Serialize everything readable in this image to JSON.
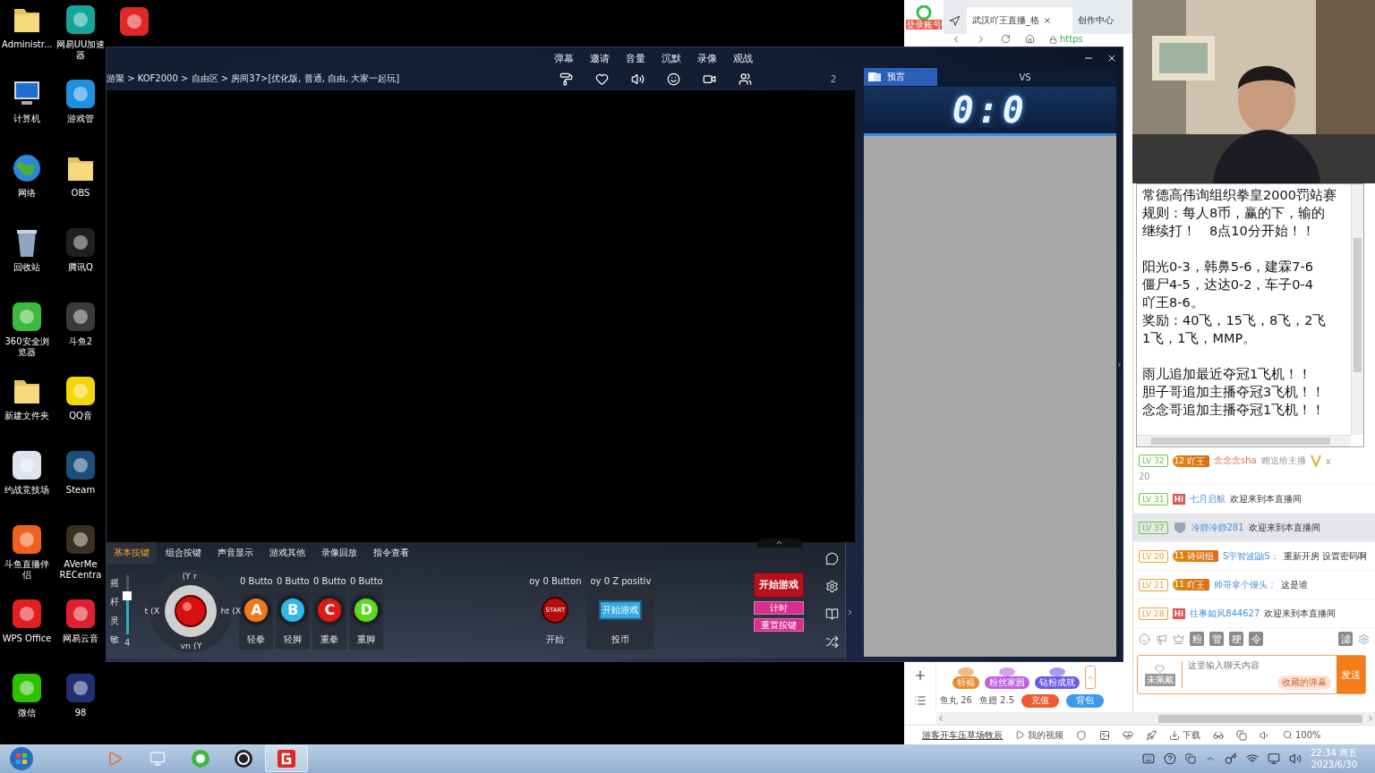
{
  "desktop": {
    "icons": [
      {
        "label": "Administr...",
        "kind": "folder"
      },
      {
        "label": "计算机",
        "kind": "computer"
      },
      {
        "label": "网络",
        "kind": "globe"
      },
      {
        "label": "回收站",
        "kind": "bin"
      },
      {
        "label": "360安全浏览器",
        "kind": "app",
        "color": "#3cba3c"
      },
      {
        "label": "新建文件夹",
        "kind": "folder"
      },
      {
        "label": "约战竞技场",
        "kind": "app",
        "color": "#dfe3f0"
      },
      {
        "label": "斗鱼直播伴侣",
        "kind": "app",
        "color": "#f06020"
      },
      {
        "label": "WPS Office",
        "kind": "app",
        "color": "#e02020"
      },
      {
        "label": "微信",
        "kind": "app",
        "color": "#2dc100"
      },
      {
        "label": "网易UU加速器",
        "kind": "app",
        "color": "#13a59a"
      },
      {
        "label": "游戏管",
        "kind": "app",
        "color": "#1e90e0"
      },
      {
        "label": "OBS",
        "kind": "folder"
      },
      {
        "label": "腾讯Q",
        "kind": "app",
        "color": "#202020"
      },
      {
        "label": "斗鱼2",
        "kind": "app",
        "color": "#3a3a3a"
      },
      {
        "label": "QQ音",
        "kind": "app",
        "color": "#f2d60a"
      },
      {
        "label": "Steam",
        "kind": "app",
        "color": "#1b4f7a"
      },
      {
        "label": "AVerMe RECentra",
        "kind": "app",
        "color": "#3a3020"
      },
      {
        "label": "网易云音",
        "kind": "app",
        "color": "#e02030"
      },
      {
        "label": "98",
        "kind": "app",
        "color": "#203070"
      },
      {
        "kind": "app",
        "color": "#e02828"
      }
    ]
  },
  "game": {
    "menu": [
      "弹幕",
      "邀请",
      "音量",
      "沉默",
      "录像",
      "观战"
    ],
    "breadcrumb": "游聚 > KOF2000 > 自由区 > 房间37>[优化版, 普通, 自由, 大家一起玩]",
    "count": "2",
    "panel": {
      "tabs": [
        {
          "label": "基本按键",
          "selected": true
        },
        {
          "label": "组合按键",
          "selected": false
        },
        {
          "label": "声音显示",
          "selected": false
        },
        {
          "label": "游戏其他",
          "selected": false
        },
        {
          "label": "录像回放",
          "selected": false
        },
        {
          "label": "指令查看",
          "selected": false
        }
      ],
      "sensitivity": {
        "label": "摇杆灵敏",
        "level": 0.65,
        "value": "4"
      },
      "joystick": {
        "up": "(Y r",
        "left": "t (X",
        "right": "ht (X",
        "down": "vn (Y"
      },
      "buttons": [
        {
          "key": "A",
          "mapping": "0 Butto",
          "label": "轻拳",
          "color": "#f07820"
        },
        {
          "key": "B",
          "mapping": "0 Butto",
          "label": "轻脚",
          "color": "#30b8e8"
        },
        {
          "key": "C",
          "mapping": "0 Butto",
          "label": "重拳",
          "color": "#e01818"
        },
        {
          "key": "D",
          "mapping": "0 Butto",
          "label": "重脚",
          "color": "#5fd820"
        }
      ],
      "extras": [
        {
          "kind": "start",
          "mapping": "oy 0 Button",
          "face": "START",
          "label": "开始"
        },
        {
          "kind": "coin",
          "mapping": "oy 0 Z positiv",
          "face": "开始游戏",
          "label": "投币"
        }
      ],
      "start": "开始游戏",
      "timer": "计时",
      "reset": "重置按键"
    },
    "side": {
      "predict": "预言",
      "vs": "VS",
      "score": "0:0"
    }
  },
  "browser": {
    "login": "登录账号",
    "tabs": [
      {
        "title": "武汉吖王直播_格",
        "selected": true
      },
      {
        "title": "创作中心",
        "selected": false
      }
    ],
    "address": "https",
    "announcement": [
      [
        "常德高伟询组织拳皇2000罚站赛",
        "规则：每人8币，赢的下，输的",
        "继续打！　8点10分开始！！"
      ],
      [
        "阳光0-3，韩鼻5-6，建霖7-6",
        "僵尸4-5，达达0-2，车子0-4",
        "吖王8-6。",
        "奖励：40飞，15飞，8飞，2飞",
        "1飞，1飞，MMP。"
      ],
      [
        "雨儿追加最近夺冠1飞机！！",
        "胆子哥追加主播夺冠3飞机！！",
        "念念哥追加主播夺冠1飞机！！"
      ]
    ],
    "chat": [
      {
        "kind": "gift",
        "level": "LV 32",
        "color": "#6cc644",
        "badge": {
          "kind": "medal",
          "number": "12",
          "text": "吖王"
        },
        "name": "念念念sha",
        "text": "赠送给主播",
        "times": "x",
        "count": "20",
        "selected": false
      },
      {
        "kind": "message",
        "level": "LV 31",
        "color": "#6cc644",
        "badge": {
          "kind": "tag",
          "text": "Hi"
        },
        "name": "七月启航",
        "text": "欢迎来到本直播间",
        "selected": false
      },
      {
        "kind": "message",
        "level": "LV 37",
        "color": "#6cc644",
        "badge": {
          "kind": "shield"
        },
        "name": "冷静冷静281",
        "text": "欢迎来到本直播间",
        "selected": true
      },
      {
        "kind": "message",
        "level": "LV 20",
        "color": "#f0a030",
        "badge": {
          "kind": "medal",
          "number": "11",
          "text": "诗词组"
        },
        "name": "S宇智波鼬S：",
        "text": "重新开房  设置密码啊",
        "selected": false
      },
      {
        "kind": "message",
        "level": "LV 21",
        "color": "#f0a030",
        "badge": {
          "kind": "medal",
          "number": "11",
          "text": "吖王"
        },
        "name": "帅哥拿个馒头：",
        "text": "这是谁",
        "selected": false
      },
      {
        "kind": "message",
        "level": "LV 28",
        "color": "#f0a030",
        "badge": {
          "kind": "tag",
          "text": "Hi"
        },
        "name": "往事如风844627",
        "text": "欢迎来到本直播间",
        "selected": false
      }
    ],
    "chat_tools": [
      "粉",
      "管",
      "梗",
      "令"
    ],
    "filter": "滤",
    "input": {
      "badge": "未佩戴",
      "placeholder": "这里输入聊天内容",
      "saved": "收藏的弹幕",
      "send": "发送"
    },
    "gifts": [
      {
        "label": "祈福",
        "color": "#e88a30"
      },
      {
        "label": "粉丝家园",
        "color": "#c060e0"
      },
      {
        "label": "钻粉成就",
        "color": "#6a5ae8"
      }
    ],
    "wallet": {
      "fishball": "鱼丸 26",
      "fin": "鱼翅 2.5",
      "recharge": "充值",
      "bag": "背包"
    },
    "status": {
      "link": "游客开车压草场牧辰",
      "videos": "我的视频",
      "download": "下载",
      "zoom": "100%"
    }
  },
  "taskbar": {
    "time": "22:34 周五",
    "date": "2023/6/30"
  }
}
